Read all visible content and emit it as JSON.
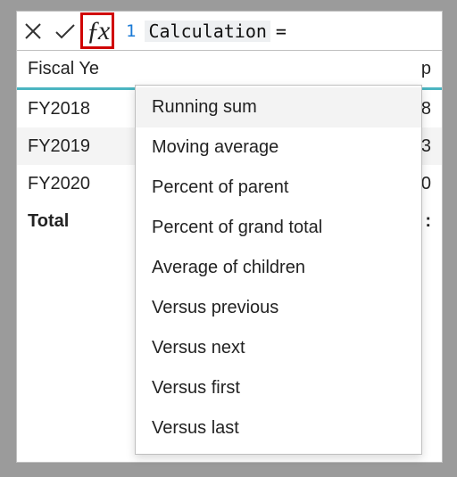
{
  "formula_bar": {
    "line_number": "1",
    "calc_token": "Calculation",
    "equals": "="
  },
  "table": {
    "header_col1": "Fiscal Ye",
    "header_trail": "p",
    "rows": [
      {
        "label": "FY2018",
        "trail": "8",
        "alt": false
      },
      {
        "label": "FY2019",
        "trail": "3",
        "alt": true
      },
      {
        "label": "FY2020",
        "trail": "0",
        "alt": false
      }
    ],
    "total_label": "Total",
    "total_trail": ":"
  },
  "suggestions": [
    "Running sum",
    "Moving average",
    "Percent of parent",
    "Percent of grand total",
    "Average of children",
    "Versus previous",
    "Versus next",
    "Versus first",
    "Versus last"
  ]
}
